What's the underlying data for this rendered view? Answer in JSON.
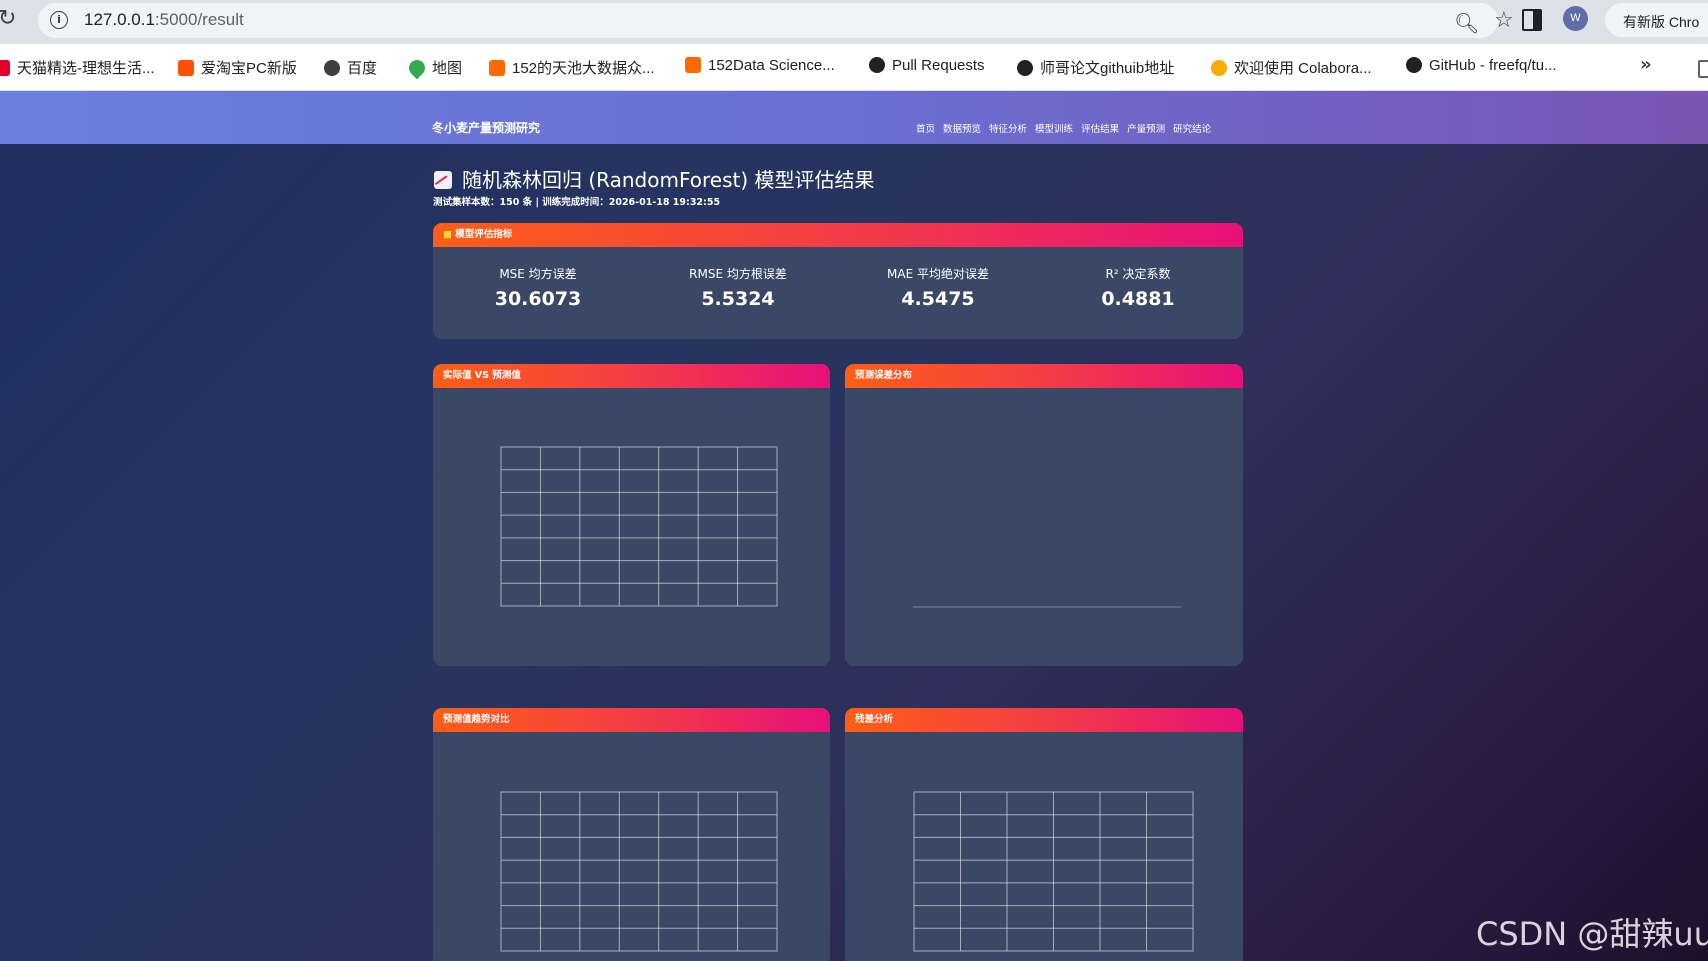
{
  "browser": {
    "url_host": "127.0.0.1",
    "url_rest": ":5000/result",
    "update_label": "有新版 Chro",
    "avatar_letter": "W",
    "bookmarks": [
      {
        "label": "天猫精选-理想生活...",
        "icon": "tmall-icon",
        "color": "#e4002b"
      },
      {
        "label": "爱淘宝PC新版",
        "icon": "taobao-icon",
        "color": "#ff5000"
      },
      {
        "label": "百度",
        "icon": "globe-icon",
        "color": "#3c4043"
      },
      {
        "label": "地图",
        "icon": "maps-pin-icon",
        "color": "#34a853"
      },
      {
        "label": "152的天池大数据众...",
        "icon": "tianchi-icon",
        "color": "#ff6a00"
      },
      {
        "label": "152Data Science...",
        "icon": "tianchi-icon",
        "color": "#ff6a00"
      },
      {
        "label": "Pull Requests",
        "icon": "github-icon",
        "color": "#202124"
      },
      {
        "label": "师哥论文githuib地址",
        "icon": "github-icon",
        "color": "#202124"
      },
      {
        "label": "欢迎使用 Colabora...",
        "icon": "colab-icon",
        "color": "#f9ab00"
      },
      {
        "label": "GitHub - freefq/tu...",
        "icon": "github-icon",
        "color": "#202124"
      }
    ]
  },
  "navbar": {
    "brand": "冬小麦产量预测研究",
    "links": [
      "首页",
      "数据预览",
      "特征分析",
      "模型训练",
      "评估结果",
      "产量预测",
      "研究结论"
    ]
  },
  "header": {
    "title": "随机森林回归 (RandomForest) 模型评估结果",
    "subtitle": "测试集样本数：150 条 | 训练完成时间：2026-01-18 19:32:55"
  },
  "metrics_card": {
    "title": "模型评估指标",
    "items": [
      {
        "label": "MSE 均方误差",
        "value": "30.6073"
      },
      {
        "label": "RMSE 均方根误差",
        "value": "5.5324"
      },
      {
        "label": "MAE 平均绝对误差",
        "value": "4.5475"
      },
      {
        "label": "R² 决定系数",
        "value": "0.4881"
      }
    ]
  },
  "cards": {
    "actual_vs_pred": "实际值 VS 预测值",
    "error_dist": "预测误差分布",
    "trend": "预测值趋势对比",
    "residual": "残差分析"
  },
  "watermark": "CSDN @甜辣uu",
  "colors": {
    "actual": "#1f6fe0",
    "predicted": "#f26a1b",
    "residual": "#e0206e",
    "header_from": "#ff5e17",
    "header_to": "#e8107a"
  },
  "chart_data": [
    {
      "type": "scatter",
      "title": "",
      "xlabel": "",
      "ylabel": "",
      "series": [],
      "note_unreadable": true
    },
    {
      "type": "bar",
      "title": "",
      "categories": [],
      "values": [],
      "note_unreadable": true
    },
    {
      "type": "scatter",
      "title": "",
      "series": [],
      "note_unreadable": true
    },
    {
      "type": "scatter",
      "title": "",
      "series": [],
      "note_unreadable": true
    }
  ]
}
